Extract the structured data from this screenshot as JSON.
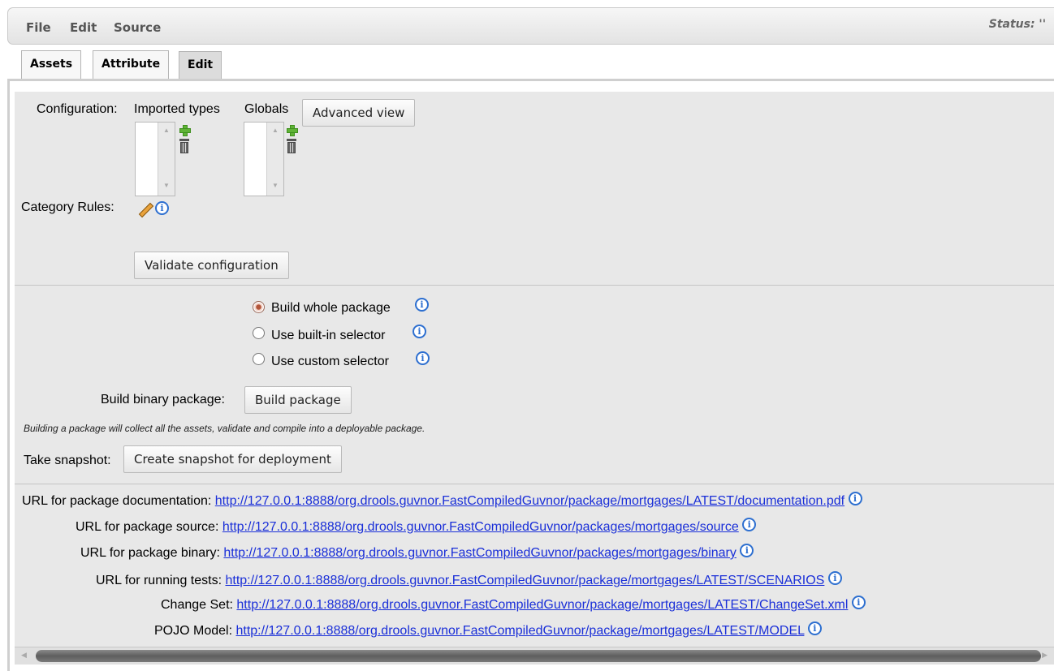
{
  "menubar": {
    "items": [
      "File",
      "Edit",
      "Source"
    ],
    "status": "Status: ''"
  },
  "tabs": [
    {
      "label": "Assets"
    },
    {
      "label": "Attribute"
    },
    {
      "label": "Edit",
      "active": true
    }
  ],
  "config": {
    "label": "Configuration:",
    "imported_types_label": "Imported types",
    "globals_label": "Globals",
    "advanced_view_button": "Advanced view",
    "category_rules_label": "Category Rules:",
    "validate_button": "Validate configuration"
  },
  "build": {
    "options": [
      {
        "label": "Build whole package",
        "selected": true
      },
      {
        "label": "Use built-in selector",
        "selected": false
      },
      {
        "label": "Use custom selector",
        "selected": false
      }
    ],
    "binary_label": "Build binary package:",
    "build_button": "Build package",
    "note": "Building a package will collect all the assets, validate and compile into a deployable package.",
    "snapshot_label": "Take snapshot:",
    "snapshot_button": "Create snapshot for deployment"
  },
  "urls": [
    {
      "label": "URL for package documentation:",
      "url": "http://127.0.0.1:8888/org.drools.guvnor.FastCompiledGuvnor/package/mortgages/LATEST/documentation.pdf"
    },
    {
      "label": "URL for package source:",
      "url": "http://127.0.0.1:8888/org.drools.guvnor.FastCompiledGuvnor/packages/mortgages/source"
    },
    {
      "label": "URL for package binary:",
      "url": "http://127.0.0.1:8888/org.drools.guvnor.FastCompiledGuvnor/packages/mortgages/binary"
    },
    {
      "label": "URL for running tests:",
      "url": "http://127.0.0.1:8888/org.drools.guvnor.FastCompiledGuvnor/package/mortgages/LATEST/SCENARIOS"
    },
    {
      "label": "Change Set:",
      "url": "http://127.0.0.1:8888/org.drools.guvnor.FastCompiledGuvnor/package/mortgages/LATEST/ChangeSet.xml"
    },
    {
      "label": "POJO Model:",
      "url": "http://127.0.0.1:8888/org.drools.guvnor.FastCompiledGuvnor/package/mortgages/LATEST/MODEL"
    }
  ],
  "colors": {
    "link": "#1a2fd8",
    "info_icon": "#2d6fd0",
    "panel_background": "#e8e8e8"
  }
}
